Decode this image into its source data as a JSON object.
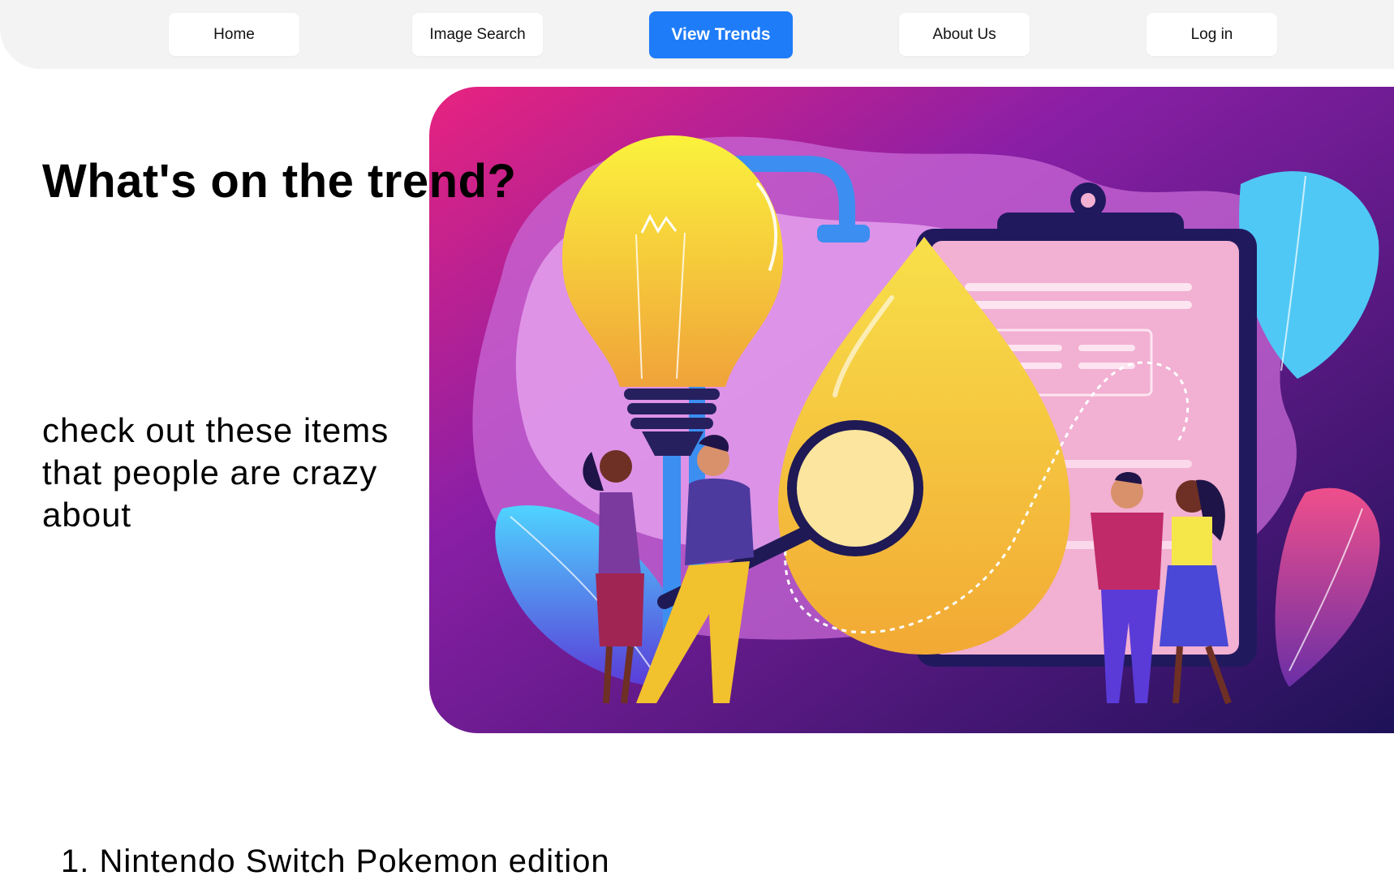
{
  "nav": {
    "items": [
      {
        "label": "Home"
      },
      {
        "label": "Image Search"
      },
      {
        "label": "View Trends",
        "active": true
      },
      {
        "label": "About Us"
      },
      {
        "label": "Log in"
      }
    ],
    "active_color": "#1e7cf8"
  },
  "hero": {
    "title": "What's on the trend?",
    "subtitle": "check out these items that people are crazy about"
  },
  "trends": {
    "items": [
      {
        "number": "1.",
        "label": "Nintendo Switch Pokemon edition"
      }
    ]
  },
  "icons": [
    "lightbulb-icon",
    "magnifying-glass-icon",
    "clipboard-icon",
    "drop-icon"
  ]
}
